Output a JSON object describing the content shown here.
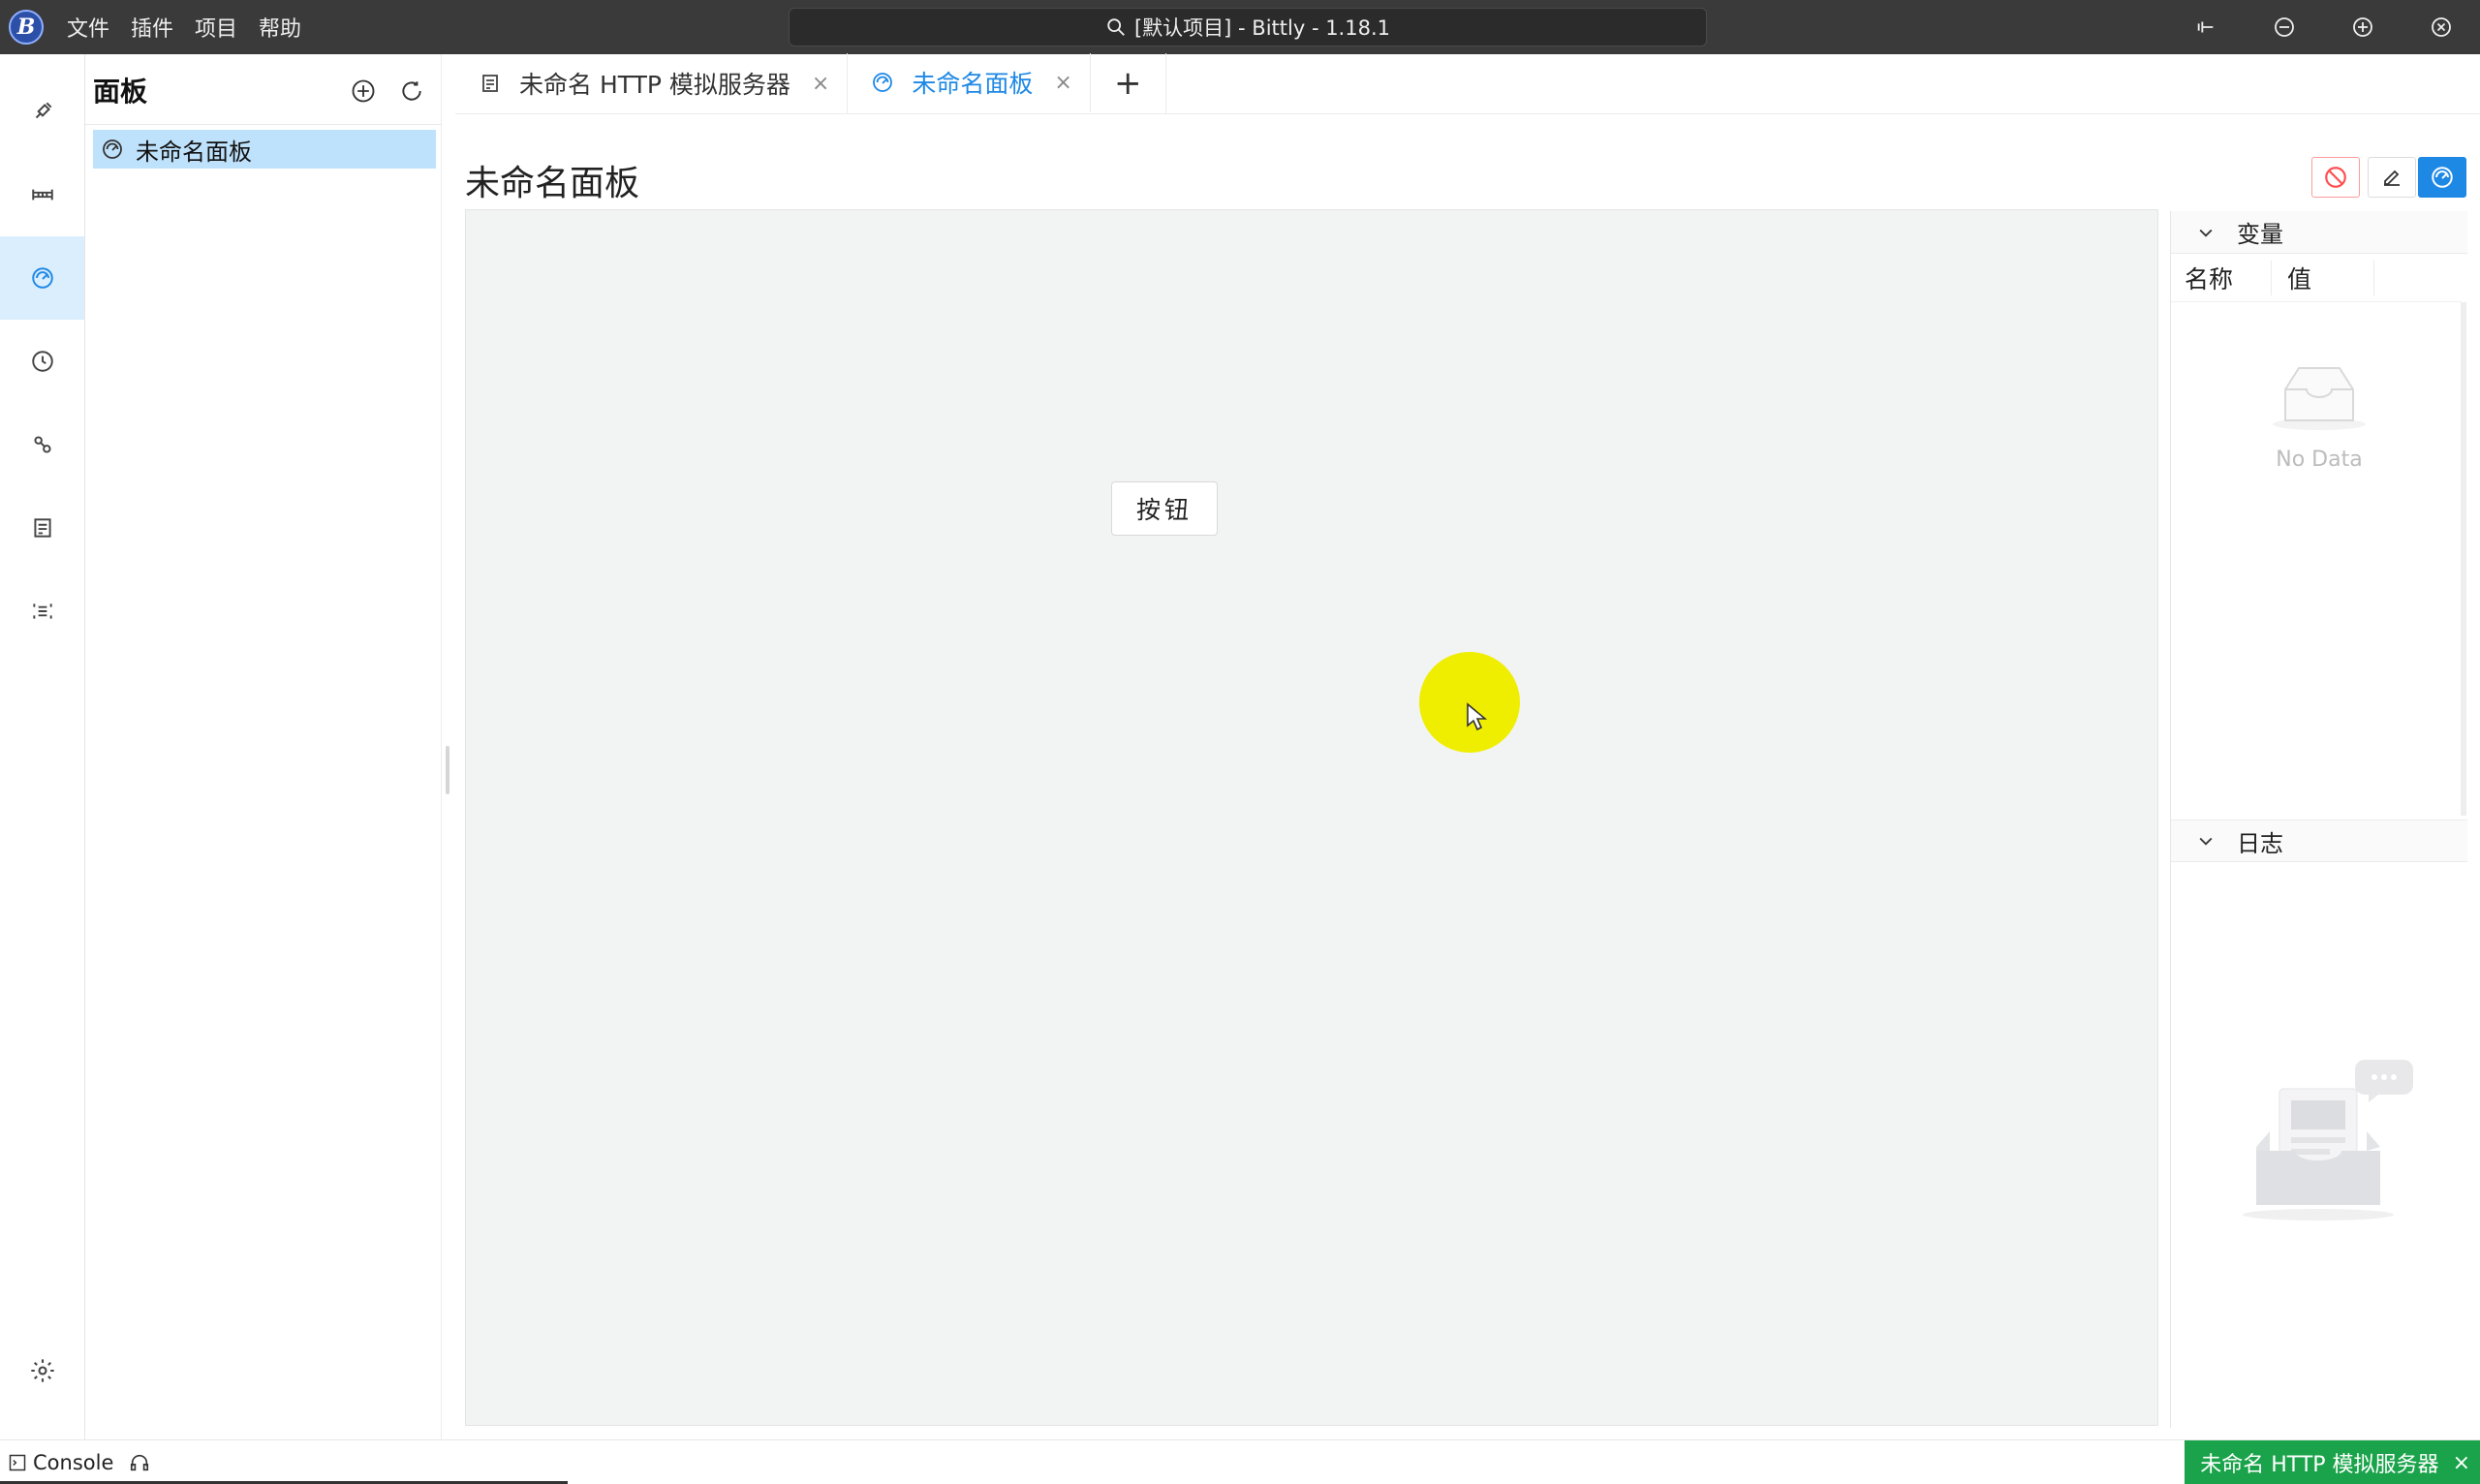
{
  "window": {
    "title": "[默认项目] - Bittly - 1.18.1",
    "logo_letter": "B"
  },
  "menu": [
    "文件",
    "插件",
    "项目",
    "帮助"
  ],
  "sidebar": {
    "title": "面板",
    "items": [
      {
        "label": "未命名面板",
        "icon": "dashboard-icon"
      }
    ]
  },
  "activity_bar": [
    {
      "icon": "plug-icon"
    },
    {
      "icon": "bridge-icon"
    },
    {
      "icon": "dashboard-icon",
      "active": true
    },
    {
      "icon": "timer-icon"
    },
    {
      "icon": "link-icon"
    },
    {
      "icon": "mock-server-icon"
    },
    {
      "icon": "list-icon"
    },
    {
      "icon": "settings-icon"
    }
  ],
  "tabs": [
    {
      "label": "未命名 HTTP 模拟服务器",
      "icon": "mock-server-icon",
      "active": false,
      "close": "×"
    },
    {
      "label": "未命名面板",
      "icon": "dashboard-icon",
      "active": true,
      "close": "×"
    }
  ],
  "tab_add_label": "+",
  "panel": {
    "title": "未命名面板",
    "widget_button_label": "按钮"
  },
  "variables": {
    "section_title": "变量",
    "columns": [
      "名称",
      "值"
    ],
    "empty_text": "No Data"
  },
  "logs": {
    "section_title": "日志"
  },
  "statusbar": {
    "console_label": "Console",
    "server_status": "未命名 HTTP 模拟服务器",
    "server_close": "×"
  },
  "colors": {
    "accent": "#1e88e5",
    "danger": "#ff4d4f",
    "success": "#1aa34a",
    "titlebar": "#3a3a3a",
    "highlight": "#f0ee00"
  }
}
